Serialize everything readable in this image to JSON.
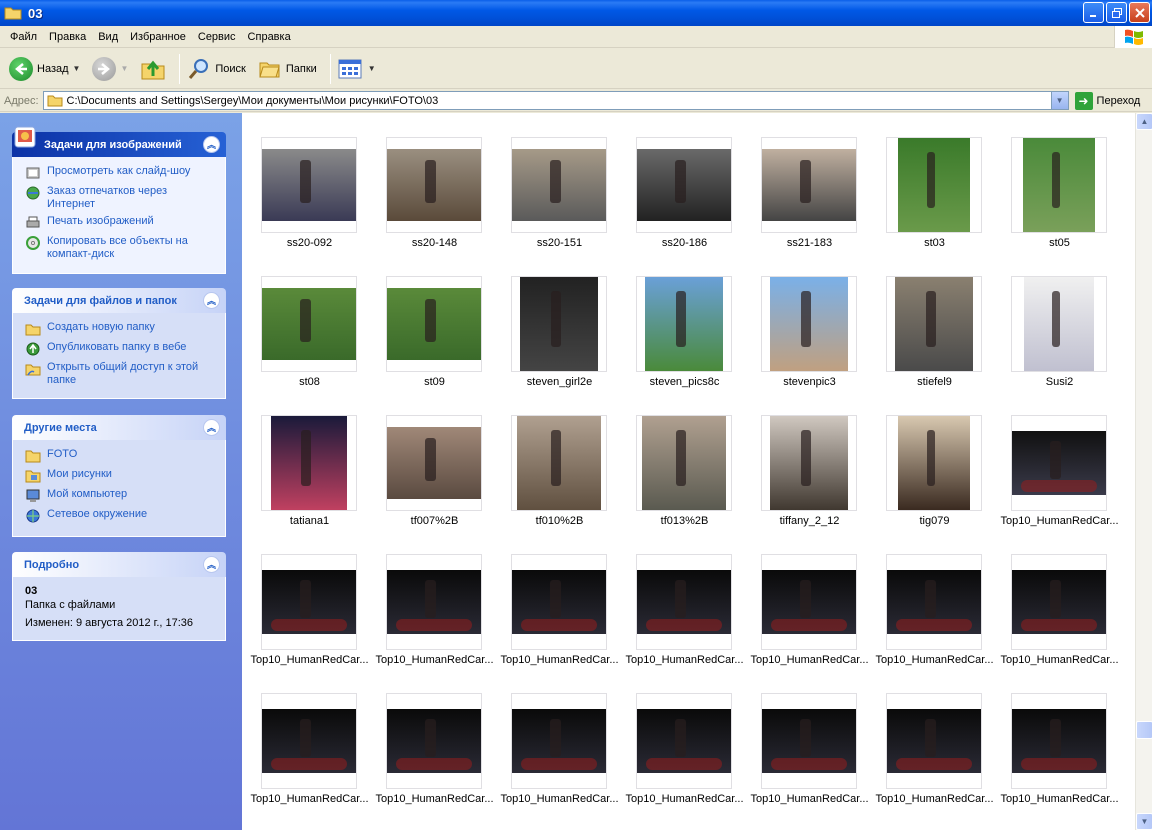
{
  "window": {
    "title": "03"
  },
  "menu": [
    "Файл",
    "Правка",
    "Вид",
    "Избранное",
    "Сервис",
    "Справка"
  ],
  "toolbar": {
    "back": "Назад",
    "search": "Поиск",
    "folders": "Папки"
  },
  "address": {
    "label": "Адрес:",
    "path": "C:\\Documents and Settings\\Sergey\\Мои документы\\Мои рисунки\\FOTO\\03",
    "go": "Переход"
  },
  "panels": {
    "image_tasks": {
      "title": "Задачи для изображений",
      "items": [
        "Просмотреть как слайд-шоу",
        "Заказ отпечатков через Интернет",
        "Печать изображений",
        "Копировать все объекты на компакт-диск"
      ]
    },
    "file_tasks": {
      "title": "Задачи для файлов и папок",
      "items": [
        "Создать новую папку",
        "Опубликовать папку в вебе",
        "Открыть общий доступ к этой папке"
      ]
    },
    "other_places": {
      "title": "Другие места",
      "items": [
        "FOTO",
        "Мои рисунки",
        "Мой компьютер",
        "Сетевое окружение"
      ]
    },
    "details": {
      "title": "Подробно",
      "name": "03",
      "type": "Папка с файлами",
      "modified": "Изменен: 9 августа 2012 г., 17:36"
    }
  },
  "files": [
    "ss20-092",
    "ss20-148",
    "ss20-151",
    "ss20-186",
    "ss21-183",
    "st03",
    "st05",
    "st08",
    "st09",
    "steven_girl2e",
    "steven_pics8c",
    "stevenpic3",
    "stiefel9",
    "Susi2",
    "tatiana1",
    "tf007%2B",
    "tf010%2B",
    "tf013%2B",
    "tiffany_2_12",
    "tig079",
    "Top10_HumanRedCar...",
    "Top10_HumanRedCar...",
    "Top10_HumanRedCar...",
    "Top10_HumanRedCar...",
    "Top10_HumanRedCar...",
    "Top10_HumanRedCar...",
    "Top10_HumanRedCar...",
    "Top10_HumanRedCar...",
    "Top10_HumanRedCar...",
    "Top10_HumanRedCar...",
    "Top10_HumanRedCar...",
    "Top10_HumanRedCar...",
    "Top10_HumanRedCar...",
    "Top10_HumanRedCar...",
    "Top10_HumanRedCar..."
  ]
}
